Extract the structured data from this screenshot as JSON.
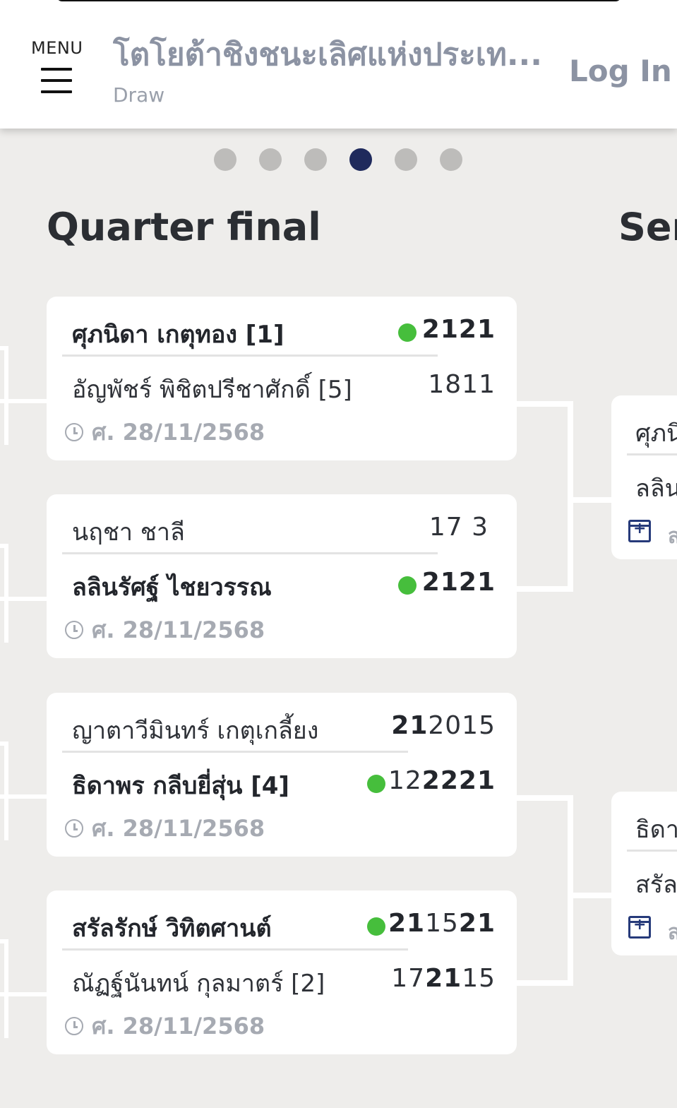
{
  "header": {
    "menu_label": "MENU",
    "title": "โตโยต้าชิงชนะเลิศแห่งประเท...",
    "subtitle": "Draw",
    "login_label": "Log In"
  },
  "pager": {
    "count": 6,
    "active_index": 3
  },
  "rounds": {
    "quarter_final_title": "Quarter final",
    "semi_final_title_partial": "Ser"
  },
  "matches": [
    {
      "p1": {
        "name": "ศุภนิดา เกตุทอง [1]",
        "score_parts": [
          {
            "t": "2121",
            "b": true
          }
        ],
        "winner": true
      },
      "p2": {
        "name": "อัญพัชร์ พิชิตปรีชาศักดิ์ [5]",
        "score_parts": [
          {
            "t": "1811",
            "b": false
          }
        ],
        "winner": false
      },
      "date": "ศ. 28/11/2568"
    },
    {
      "p1": {
        "name": "นฤชา ชาลี",
        "score_parts": [
          {
            "t": "17 3",
            "b": false
          }
        ],
        "winner": false
      },
      "p2": {
        "name": "ลลินรัศฐ์ ไชยวรรณ",
        "score_parts": [
          {
            "t": "2121",
            "b": true
          }
        ],
        "winner": true
      },
      "date": "ศ. 28/11/2568"
    },
    {
      "p1": {
        "name": "ญาตาวีมินทร์ เกตุเกลี้ยง",
        "score_parts": [
          {
            "t": "21",
            "b": true
          },
          {
            "t": "2015",
            "b": false
          }
        ],
        "winner": false
      },
      "p2": {
        "name": "ธิดาพร กลีบยี่สุ่น [4]",
        "score_parts": [
          {
            "t": "12",
            "b": false
          },
          {
            "t": "2221",
            "b": true
          }
        ],
        "winner": true
      },
      "date": "ศ. 28/11/2568"
    },
    {
      "p1": {
        "name": "สรัลรักษ์ วิทิตศานต์",
        "score_parts": [
          {
            "t": "21",
            "b": true
          },
          {
            "t": "15",
            "b": false
          },
          {
            "t": "21",
            "b": true
          }
        ],
        "winner": true
      },
      "p2": {
        "name": "ณัฏฐ์นันทน์ กุลมาตร์ [2]",
        "score_parts": [
          {
            "t": "17",
            "b": false
          },
          {
            "t": "21",
            "b": true
          },
          {
            "t": "15",
            "b": false
          }
        ],
        "winner": false
      },
      "date": "ศ. 28/11/2568"
    }
  ],
  "semi_matches": [
    {
      "p1": "ศุภนิ",
      "p2": "ลลิน",
      "date": "ส"
    },
    {
      "p1": "ธิดา",
      "p2": "สรัล",
      "date": "ส"
    }
  ],
  "colors": {
    "background": "#eeedeb",
    "winner_dot": "#46be3c",
    "pager_active": "#1f2a5c",
    "pager_inactive": "#bdbcba",
    "header_text": "#8c93a3",
    "calendar_icon": "#263a7a"
  },
  "icons": {
    "menu": "hamburger-icon",
    "date": "clock-icon",
    "semi_date": "calendar-plus-icon"
  }
}
